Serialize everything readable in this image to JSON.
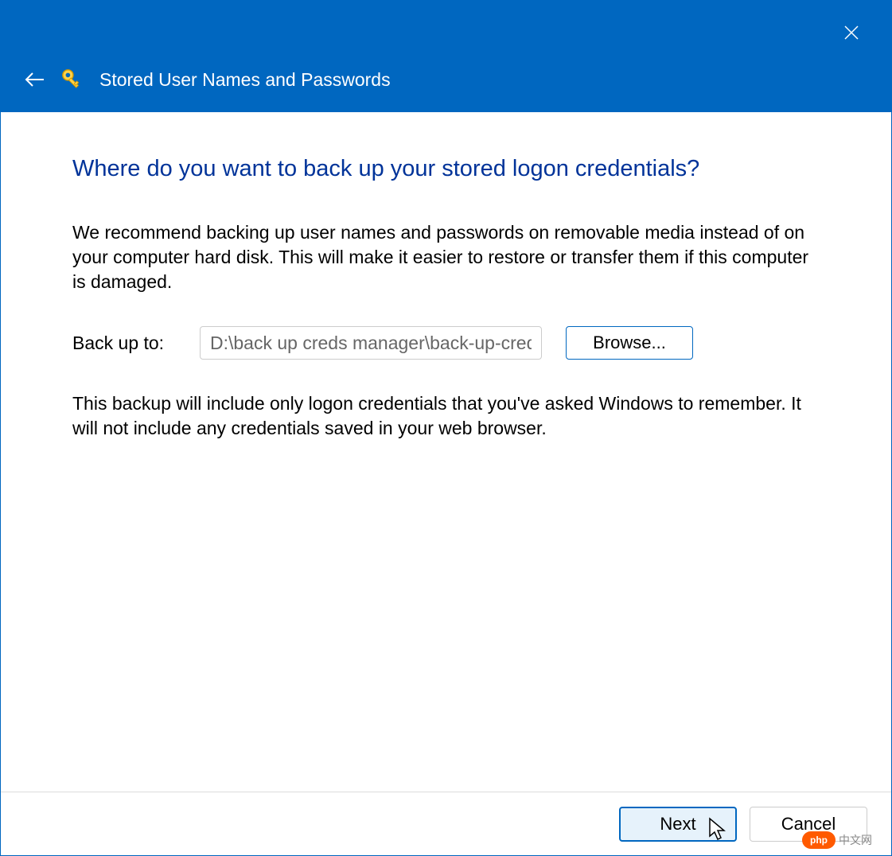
{
  "titlebar": {
    "title": "Stored User Names and Passwords"
  },
  "main": {
    "heading": "Where do you want to back up your stored logon credentials?",
    "description": "We recommend backing up user names and passwords on removable media instead of on your computer hard disk. This will make it easier to restore or transfer them if this computer is damaged.",
    "backup_label": "Back up to:",
    "backup_path": "D:\\back up creds manager\\back-up-cred",
    "browse_label": "Browse...",
    "description2": "This backup will include only logon credentials that you've asked Windows to remember. It will not include any credentials saved in your web browser."
  },
  "footer": {
    "next_label": "Next",
    "cancel_label": "Cancel"
  },
  "watermark": {
    "badge": "php",
    "text": "中文网"
  },
  "colors": {
    "accent": "#0067c0",
    "heading": "#003399"
  }
}
